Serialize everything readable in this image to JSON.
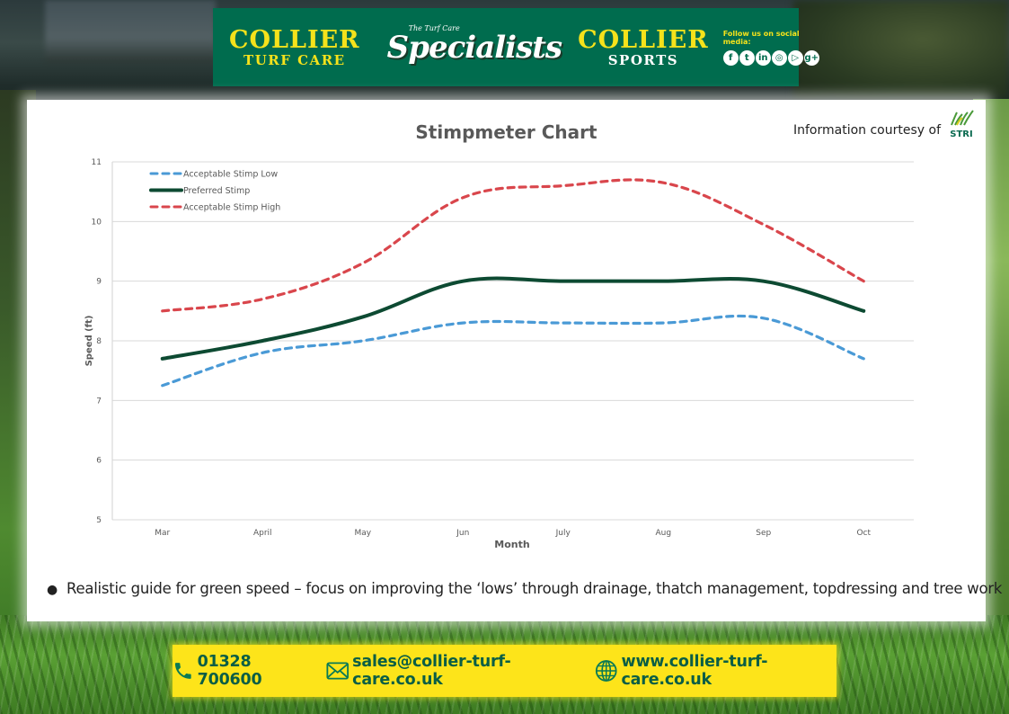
{
  "header": {
    "brand_left": {
      "line1": "COLLIER",
      "line2": "TURF CARE"
    },
    "tagline_small": "The Turf Care",
    "tagline": "Specialists",
    "brand_right": {
      "line1": "COLLIER",
      "line2": "SPORTS"
    },
    "social_label": "Follow us on social media:",
    "social_icons": [
      "facebook-icon",
      "twitter-icon",
      "linkedin-icon",
      "instagram-icon",
      "youtube-icon",
      "google-plus-icon"
    ]
  },
  "courtesy": {
    "text": "Information courtesy of",
    "logo_text": "STRI"
  },
  "bullet": "Realistic guide for green speed – focus on improving the ‘lows’ through drainage, thatch management, topdressing and tree work",
  "footer": {
    "phone": "01328 700600",
    "email": "sales@collier-turf-care.co.uk",
    "website": "www.collier-turf-care.co.uk"
  },
  "colors": {
    "header_green": "#006c4e",
    "brand_yellow": "#f5e21b",
    "footer_yellow": "#fde41a",
    "footer_text": "#0a5e45",
    "low_series": "#4a9ad6",
    "preferred_series": "#0d4a32",
    "high_series": "#d9464c"
  },
  "chart_data": {
    "type": "line",
    "title": "Stimpmeter Chart",
    "xlabel": "Month",
    "ylabel": "Speed (ft)",
    "categories": [
      "Mar",
      "April",
      "May",
      "Jun",
      "July",
      "Aug",
      "Sep",
      "Oct"
    ],
    "ylim": [
      5,
      11
    ],
    "yticks": [
      5,
      6,
      7,
      8,
      9,
      10,
      11
    ],
    "grid": true,
    "legend_position": "top-left",
    "series": [
      {
        "name": "Acceptable Stimp Low",
        "style": "dashed",
        "color": "#4a9ad6",
        "values": [
          7.25,
          7.8,
          8.0,
          8.3,
          8.3,
          8.3,
          8.38,
          7.7
        ]
      },
      {
        "name": "Preferred Stimp",
        "style": "solid",
        "color": "#0d4a32",
        "values": [
          7.7,
          8.0,
          8.4,
          9.0,
          9.0,
          9.0,
          9.0,
          8.5
        ]
      },
      {
        "name": "Acceptable Stimp High",
        "style": "dashed",
        "color": "#d9464c",
        "values": [
          8.5,
          8.7,
          9.3,
          10.4,
          10.6,
          10.65,
          9.95,
          9.0
        ]
      }
    ]
  }
}
